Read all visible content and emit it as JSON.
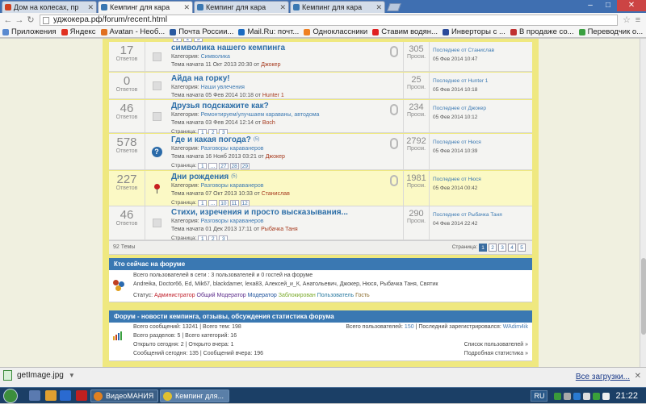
{
  "browser": {
    "tabs": [
      {
        "label": "Дом на колесах, пр",
        "favicon": "#d04020",
        "active": false
      },
      {
        "label": "Кемпинг для кара",
        "favicon": "#3a78b2",
        "active": true
      },
      {
        "label": "Кемпинг для кара",
        "favicon": "#3a78b2",
        "active": false
      },
      {
        "label": "Кемпинг для кара",
        "favicon": "#3a78b2",
        "active": false
      }
    ],
    "url": "уджокера.рф/forum/recent.html",
    "bookmarks": [
      {
        "label": "Приложения",
        "color": "#5a8ad0"
      },
      {
        "label": "Яндекс",
        "color": "#e03020"
      },
      {
        "label": "Avatan - Необ...",
        "color": "#e07020"
      },
      {
        "label": "Почта России...",
        "color": "#2a5aa0"
      },
      {
        "label": "Mail.Ru: почт...",
        "color": "#1a6ac0"
      },
      {
        "label": "Одноклассники",
        "color": "#f08020"
      },
      {
        "label": "Ставим водян...",
        "color": "#e02020"
      },
      {
        "label": "Инверторы с ...",
        "color": "#2a4a9a"
      },
      {
        "label": "В продаже со...",
        "color": "#c03030"
      },
      {
        "label": "Переводчик о...",
        "color": "#3aa040"
      }
    ]
  },
  "topics": [
    {
      "answers": "17",
      "answers_label": "Ответов",
      "icon": "read",
      "title": "символика нашего кемпинга",
      "badge": "",
      "category_label": "Категория:",
      "category": "Символика",
      "started_text": "Тема начата 11 Окт 2013 20:30 от",
      "author": "Джокер",
      "pages_label": "Страница:",
      "pages": [],
      "attachment": true,
      "replies": "305",
      "replies_label": "Просм.",
      "last_label": "Последнее от",
      "last_user": "Станислав",
      "last_date": "05 Фев 2014 10:47",
      "highlight": false
    },
    {
      "answers": "0",
      "answers_label": "Ответов",
      "icon": "read",
      "title": "Айда на горку!",
      "badge": "",
      "category_label": "Категория:",
      "category": "Наши увлечения",
      "started_text": "Тема начата 05 Фев 2014 10:18 от",
      "author": "Hunter 1",
      "pages_label": "",
      "pages": [],
      "attachment": false,
      "replies": "25",
      "replies_label": "Просм.",
      "last_label": "Последнее от",
      "last_user": "Hunter 1",
      "last_date": "05 Фев 2014 10:18",
      "highlight": false
    },
    {
      "answers": "46",
      "answers_label": "Ответов",
      "icon": "read",
      "title": "Друзья подскажите как?",
      "badge": "",
      "category_label": "Категория:",
      "category": "Ремонтируем/улучшаем караваны, автодома",
      "started_text": "Тема начата 03 Фев 2014 12:14 от",
      "author": "Boch",
      "pages_label": "Страница:",
      "pages": [
        "1",
        "2",
        "3"
      ],
      "attachment": true,
      "replies": "234",
      "replies_label": "Просм.",
      "last_label": "Последнее от",
      "last_user": "Джокер",
      "last_date": "05 Фев 2014 10:12",
      "highlight": false
    },
    {
      "answers": "578",
      "answers_label": "Ответов",
      "icon": "question",
      "title": "Где и какая погода?",
      "badge": "(5)",
      "category_label": "Категория:",
      "category": "Разговоры караванеров",
      "started_text": "Тема начата 16 Нояб 2013 03:21 от",
      "author": "Джокер",
      "pages_label": "Страница:",
      "pages": [
        "1",
        "...",
        "27",
        "28",
        "29"
      ],
      "attachment": true,
      "replies": "2792",
      "replies_label": "Просм.",
      "last_label": "Последнее от",
      "last_user": "Нюся",
      "last_date": "05 Фев 2014 10:39",
      "highlight": false
    },
    {
      "answers": "227",
      "answers_label": "Ответов",
      "icon": "pin",
      "title": "Дни рождения",
      "badge": "(5)",
      "category_label": "Категория:",
      "category": "Разговоры караванеров",
      "started_text": "Тема начата 07 Окт 2013 10:33 от",
      "author": "Станислав",
      "pages_label": "Страница:",
      "pages": [
        "1",
        "...",
        "10",
        "11",
        "12"
      ],
      "attachment": true,
      "replies": "1981",
      "replies_label": "Просм.",
      "last_label": "Последнее от",
      "last_user": "Нюся",
      "last_date": "05 Фев 2014 00:42",
      "highlight": true
    },
    {
      "answers": "46",
      "answers_label": "Ответов",
      "icon": "read",
      "title": "Стихи, изречения и просто высказывания...",
      "badge": "",
      "category_label": "Категория:",
      "category": "Разговоры караванеров",
      "started_text": "Тема начата 01 Дек 2013 17:11 от",
      "author": "Рыбачка Таня",
      "pages_label": "Страница:",
      "pages": [
        "1",
        "2",
        "3"
      ],
      "attachment": false,
      "replies": "290",
      "replies_label": "Просм.",
      "last_label": "Последнее от",
      "last_user": "Рыбачка Таня",
      "last_date": "04 Фев 2014 22:42",
      "highlight": false
    }
  ],
  "footer": {
    "count": "92 Темы",
    "page_label": "Страница:",
    "pages": [
      "1",
      "2",
      "3",
      "4",
      "5"
    ],
    "current": "1"
  },
  "online": {
    "title": "Кто сейчас на форуме",
    "summary": "Всего пользователей в сети : 3 пользователей и 0 гостей на форуме",
    "users": "Andreika, Doctor66, Ed, Mik67, blackdamer, lexa83, Алексей_и_К, Анатольевич, Джокер, Нюся, Рыбачка Таня, Святик",
    "status_label": "Статус:",
    "roles": [
      "Администратор",
      "Общий Модератор",
      "Модератор",
      "Заблокирован",
      "Пользователь",
      "Гость"
    ]
  },
  "stats": {
    "title": "Форум - новости кемпинга, отзывы, обсуждения статистика форума",
    "messages_label": "Всего сообщений:",
    "messages": "13241",
    "topics_label": "Всего тем:",
    "topics": "198",
    "sections_label": "Всего разделов:",
    "sections": "5",
    "categories_label": "Всего категорий:",
    "categories": "16",
    "open_today_label": "Открыто сегодня:",
    "open_today": "2",
    "open_yesterday_label": "Открыто вчера:",
    "open_yesterday": "1",
    "msgs_today_label": "Сообщений сегодня:",
    "msgs_today": "135",
    "msgs_yesterday_label": "Сообщений вчера:",
    "msgs_yesterday": "196",
    "users_label": "Всего пользователей:",
    "users": "150",
    "last_reg_label": "Последний зарегистрировался:",
    "last_reg": "WAdim4ik",
    "users_list_link": "Список пользователей »",
    "detailed_link": "Подробная статистика »"
  },
  "download": {
    "file": "getImage.jpg",
    "show_all": "Все загрузки..."
  },
  "taskbar": {
    "app1": "ВидеоМАНИЯ",
    "app2": "Кемпинг для...",
    "lang": "RU",
    "time": "21:22"
  }
}
